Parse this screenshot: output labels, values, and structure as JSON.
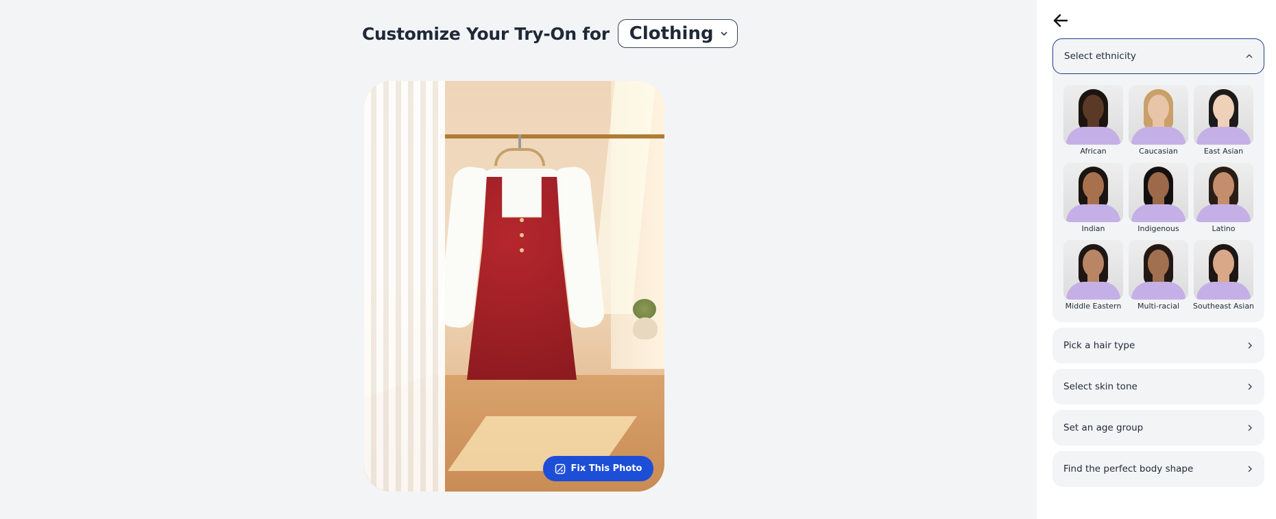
{
  "main": {
    "heading": "Customize Your Try-On for",
    "category": "Clothing",
    "fix_button": "Fix This Photo"
  },
  "panel": {
    "ethnicity_title": "Select ethnicity",
    "ethnicities": [
      {
        "label": "African",
        "skin": "#5a3a26",
        "hair": "#1b1410"
      },
      {
        "label": "Caucasian",
        "skin": "#e8c4a8",
        "hair": "#c9a06a"
      },
      {
        "label": "East Asian",
        "skin": "#efd0b8",
        "hair": "#1d1a1a"
      },
      {
        "label": "Indian",
        "skin": "#a8714e",
        "hair": "#1a1412"
      },
      {
        "label": "Indigenous",
        "skin": "#9c6a4a",
        "hair": "#141010"
      },
      {
        "label": "Latino",
        "skin": "#c48e6c",
        "hair": "#2a1d16"
      },
      {
        "label": "Middle Eastern",
        "skin": "#b88565",
        "hair": "#1e1612"
      },
      {
        "label": "Multi-racial",
        "skin": "#a07050",
        "hair": "#231914"
      },
      {
        "label": "Southeast Asian",
        "skin": "#d8a888",
        "hair": "#1c1614"
      }
    ],
    "hair_title": "Pick a hair type",
    "skin_title": "Select skin tone",
    "age_title": "Set an age group",
    "body_title": "Find the perfect body shape"
  },
  "colors": {
    "accent": "#1d4ed8",
    "outline": "#1e3a8a",
    "shirt": "#c4b0e6"
  },
  "icons": {
    "back": "arrow-left-icon",
    "category_chevron": "chevron-down-icon",
    "fix": "photo-fix-icon",
    "section_chevron": "chevron-right-icon"
  }
}
